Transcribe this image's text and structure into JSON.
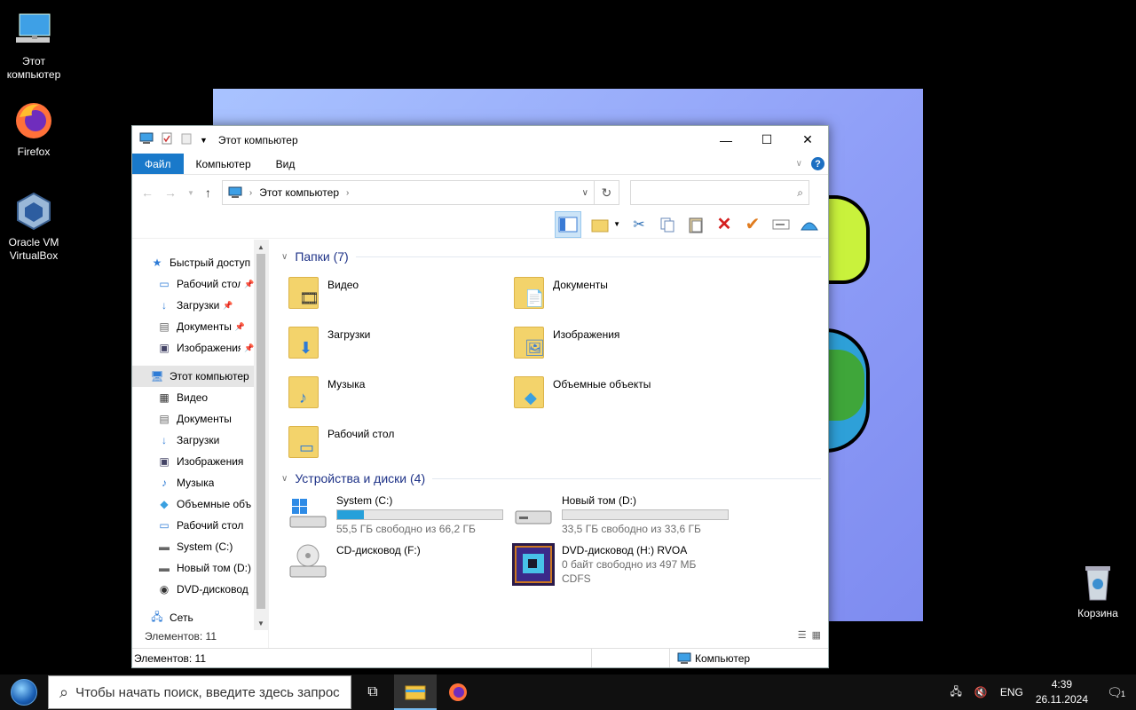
{
  "desktop": {
    "icons": [
      {
        "label": "Этот компьютер"
      },
      {
        "label": "Firefox"
      },
      {
        "label": "Oracle VM VirtualBox"
      },
      {
        "label": "Корзина"
      }
    ]
  },
  "explorer": {
    "title": "Этот компьютер",
    "ribbon_tabs": [
      "Файл",
      "Компьютер",
      "Вид"
    ],
    "address": {
      "segment": "Этот компьютер"
    },
    "nav": {
      "items": [
        {
          "label": "Быстрый доступ",
          "pin": false
        },
        {
          "label": "Рабочий стол",
          "pin": true
        },
        {
          "label": "Загрузки",
          "pin": true
        },
        {
          "label": "Документы",
          "pin": true
        },
        {
          "label": "Изображения",
          "pin": true
        },
        {
          "label": "Этот компьютер",
          "pin": false
        },
        {
          "label": "Видео",
          "pin": false
        },
        {
          "label": "Документы",
          "pin": false
        },
        {
          "label": "Загрузки",
          "pin": false
        },
        {
          "label": "Изображения",
          "pin": false
        },
        {
          "label": "Музыка",
          "pin": false
        },
        {
          "label": "Объемные объекты",
          "pin": false
        },
        {
          "label": "Рабочий стол",
          "pin": false
        },
        {
          "label": "System  (C:)",
          "pin": false
        },
        {
          "label": "Новый том (D:)",
          "pin": false
        },
        {
          "label": "DVD-дисковод (H:) RVOA",
          "pin": false
        },
        {
          "label": "Сеть",
          "pin": false
        }
      ],
      "count": "Элементов: 11"
    },
    "folders_header": "Папки (7)",
    "folders": [
      "Видео",
      "Документы",
      "Загрузки",
      "Изображения",
      "Музыка",
      "Объемные объекты",
      "Рабочий стол"
    ],
    "drives_header": "Устройства и диски (4)",
    "drives": [
      {
        "name": "System  (C:)",
        "free": "55,5 ГБ свободно из 66,2 ГБ",
        "used_fraction": 0.16
      },
      {
        "name": "Новый том (D:)",
        "free": "33,5 ГБ свободно из 33,6 ГБ",
        "used_fraction": 0.0
      },
      {
        "name": "CD-дисковод (F:)",
        "free": "",
        "used_fraction": null
      },
      {
        "name": "DVD-дисковод (H:) RVOA",
        "free": "0 байт свободно из 497 МБ",
        "fs": "CDFS",
        "used_fraction": null
      }
    ],
    "status": {
      "count": "Элементов: 11",
      "location": "Компьютер"
    }
  },
  "taskbar": {
    "search_placeholder": "Чтобы начать поиск, введите здесь запрос",
    "lang": "ENG",
    "time": "4:39",
    "date": "26.11.2024",
    "notifications": "1"
  },
  "colors": {
    "accent": "#1979ca",
    "drive_bar": "#26a0da",
    "group_header": "#1e3287"
  }
}
